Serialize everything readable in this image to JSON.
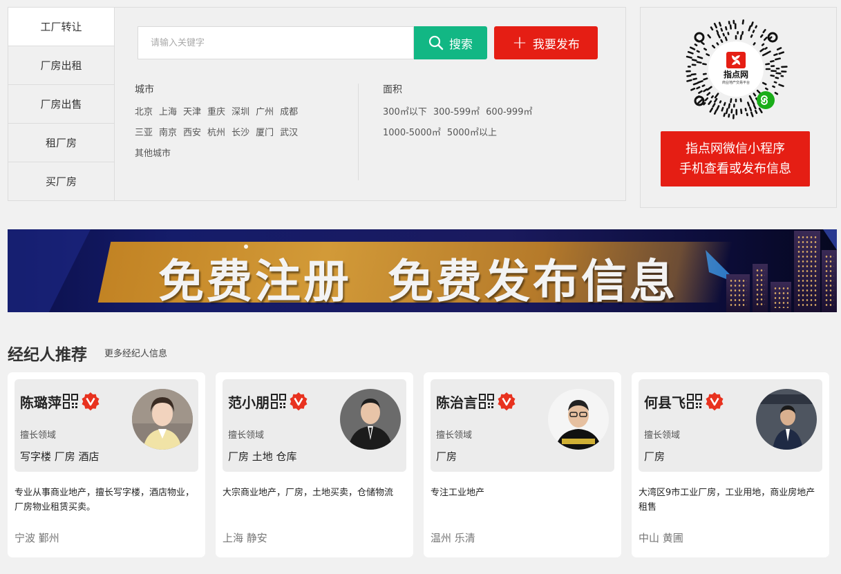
{
  "categories": [
    {
      "label": "工厂转让",
      "active": true
    },
    {
      "label": "厂房出租",
      "active": false
    },
    {
      "label": "厂房出售",
      "active": false
    },
    {
      "label": "租厂房",
      "active": false
    },
    {
      "label": "买厂房",
      "active": false
    }
  ],
  "search": {
    "placeholder": "请输入关键字",
    "search_label": "搜索",
    "publish_label": "我要发布"
  },
  "filters": {
    "city_title": "城市",
    "cities_row1": [
      "北京",
      "上海",
      "天津",
      "重庆",
      "深圳",
      "广州",
      "成都"
    ],
    "cities_row2": [
      "三亚",
      "南京",
      "西安",
      "杭州",
      "长沙",
      "厦门",
      "武汉"
    ],
    "cities_row3": [
      "其他城市"
    ],
    "area_title": "面积",
    "areas_row1": [
      "300㎡以下",
      "300-599㎡",
      "600-999㎡"
    ],
    "areas_row2": [
      "1000-5000㎡",
      "5000㎡以上"
    ]
  },
  "qr_panel": {
    "logo_text": "指点网",
    "logo_sub": "商业地产交易平台",
    "line1": "指点网微信小程序",
    "line2": "手机查看或发布信息"
  },
  "banner": {
    "part1": "免费注册",
    "part2": "免费发布信息"
  },
  "agents_section": {
    "title": "经纪人推荐",
    "more": "更多经纪人信息",
    "skill_label": "擅长领域"
  },
  "agents": [
    {
      "name": "陈璐萍",
      "skills": "写字楼 厂房 酒店",
      "desc": "专业从事商业地产，擅长写字楼，酒店物业，厂房物业租赁买卖。",
      "location": "宁波 鄞州"
    },
    {
      "name": "范小朋",
      "skills": "厂房 土地 仓库",
      "desc": "大宗商业地产，厂房，土地买卖，仓储物流",
      "location": "上海 静安"
    },
    {
      "name": "陈治言",
      "skills": "厂房",
      "desc": "专注工业地产",
      "location": "温州 乐清"
    },
    {
      "name": "何县飞",
      "skills": "厂房",
      "desc": "大湾区9市工业厂房，工业用地，商业房地产租售",
      "location": "中山 黄圃"
    }
  ],
  "colors": {
    "search_green": "#12b784",
    "publish_red": "#e51e14",
    "verified_red": "#e8321f"
  }
}
